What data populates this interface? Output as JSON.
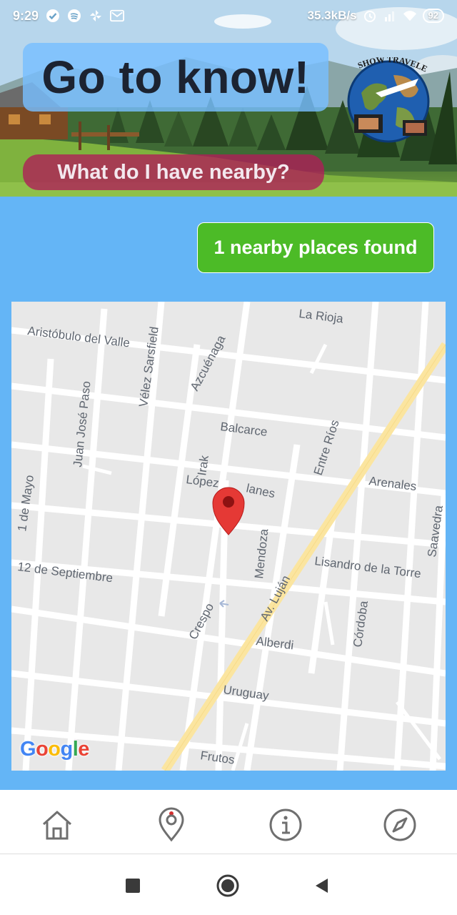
{
  "status_bar": {
    "time": "9:29",
    "network_speed": "35.3kB/s",
    "battery": "92",
    "icons": [
      "check-circle-icon",
      "spotify-icon",
      "pinwheel-icon",
      "gmail-icon",
      "alarm-icon",
      "signal-icon",
      "wifi-icon",
      "battery-icon"
    ]
  },
  "header": {
    "title": "Go to know!",
    "subtitle": "What do I have nearby?",
    "logo_text": "SHOW TRAVELERS"
  },
  "main": {
    "places_found_label": "1 nearby places found"
  },
  "map": {
    "streets": {
      "la_rioja": "La Rioja",
      "aristobulo": "Aristóbulo del Valle",
      "velez": "Vélez Sarsfield",
      "azcuenaga": "Azcuénaga",
      "juan_jose_paso": "Juan José Paso",
      "balcarce": "Balcarce",
      "irak": "Irak",
      "lopez": "López",
      "planes": "lanes",
      "entre_rios": "Entre Ríos",
      "arenales": "Arenales",
      "primero_de_mayo": "1 de Mayo",
      "saavedra": "Saavedra",
      "mendoza": "Mendoza",
      "lisandro": "Lisandro de la Torre",
      "doce_septiembre": "12 de Septiembre",
      "av_lujan": "Av. Luján",
      "crespo": "Crespo",
      "alberdi": "Alberdi",
      "cordoba": "Córdoba",
      "uruguay": "Uruguay",
      "frutos": "Frutos"
    },
    "google_letters": [
      "G",
      "o",
      "o",
      "g",
      "l",
      "e"
    ],
    "google_colors": [
      "#4285F4",
      "#EA4335",
      "#FBBC05",
      "#4285F4",
      "#34A853",
      "#EA4335"
    ],
    "marker_color": "#e53935"
  },
  "bottom_nav": {
    "items": [
      "home-icon",
      "location-pin-icon",
      "info-icon",
      "compass-icon"
    ],
    "active_indicator_color": "#d32f2f"
  },
  "system_nav": [
    "recents-button",
    "home-button",
    "back-button"
  ]
}
